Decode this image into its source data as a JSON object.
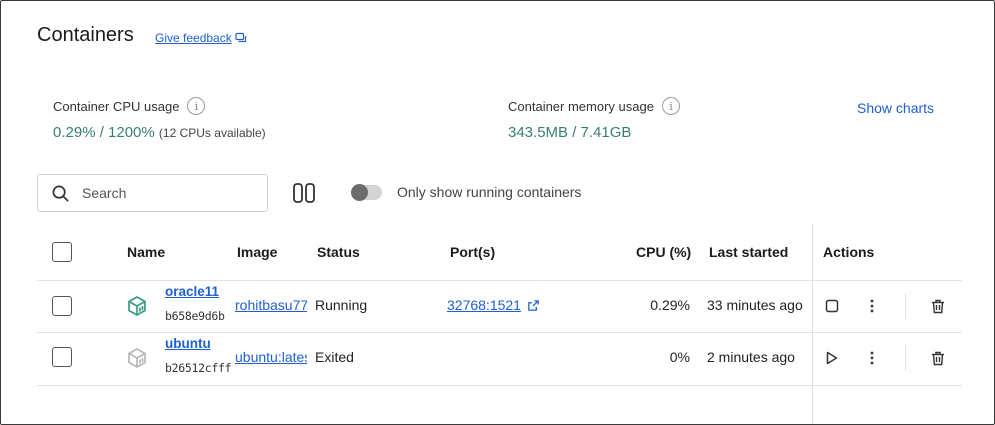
{
  "header": {
    "title": "Containers",
    "feedback_label": "Give feedback"
  },
  "stats": {
    "cpu": {
      "label": "Container CPU usage",
      "value": "0.29% / 1200%",
      "sub": "(12 CPUs available)"
    },
    "memory": {
      "label": "Container memory usage",
      "value": "343.5MB / 7.41GB"
    },
    "show_charts_label": "Show charts"
  },
  "toolbar": {
    "search_placeholder": "Search",
    "running_only_label": "Only show running containers",
    "running_only_enabled": false
  },
  "table": {
    "headers": {
      "name": "Name",
      "image": "Image",
      "status": "Status",
      "ports": "Port(s)",
      "cpu": "CPU (%)",
      "last_started": "Last started",
      "actions": "Actions"
    },
    "rows": [
      {
        "name": "oracle11",
        "id": "b658e9d6b",
        "image": "rohitbasu77",
        "status": "Running",
        "port": "32768:1521",
        "cpu": "0.29%",
        "last_started": "33 minutes ago",
        "icon_color": "#3a9a86"
      },
      {
        "name": "ubuntu",
        "id": "b26512cfff",
        "image": "ubuntu:latest",
        "status": "Exited",
        "port": "",
        "cpu": "0%",
        "last_started": "2 minutes ago",
        "icon_color": "#b8b8b8"
      }
    ]
  },
  "colors": {
    "accent": "#1f5fd1",
    "stat_value": "#3a7f72"
  }
}
